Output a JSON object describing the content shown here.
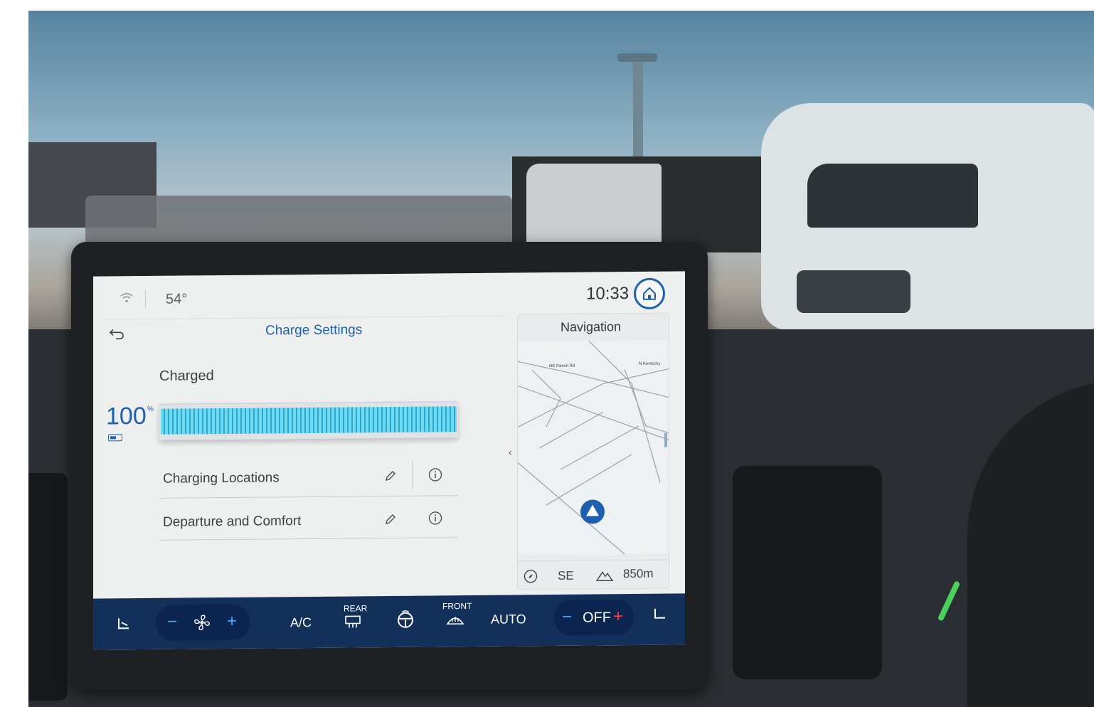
{
  "status_bar": {
    "temperature": "54°",
    "time": "10:33"
  },
  "charge_screen": {
    "title": "Charge Settings",
    "state_label": "Charged",
    "percent": "100",
    "percent_unit": "%",
    "battery_level": 1.0,
    "rows": [
      {
        "label": "Charging Locations"
      },
      {
        "label": "Departure and Comfort"
      }
    ]
  },
  "navigation": {
    "title": "Navigation",
    "streets": [
      "NE Parvin Rd",
      "N Kentucky"
    ],
    "heading": "SE",
    "elevation": "850m"
  },
  "climate": {
    "rear_label": "REAR",
    "front_label": "FRONT",
    "ac_label": "A/C",
    "auto_label": "AUTO",
    "off_label": "OFF",
    "minus": "−",
    "plus": "+"
  },
  "colors": {
    "accent": "#1f5fb0",
    "bar": "#3fc6e0",
    "climate_bg": "#12305a"
  },
  "icons": [
    "wifi-icon",
    "home-icon",
    "back-arrow-icon",
    "battery-icon",
    "pencil-icon",
    "info-icon",
    "compass-icon",
    "mountain-icon",
    "seat-heat-icon",
    "fan-icon",
    "rear-defrost-icon",
    "steering-heat-icon",
    "front-defrost-icon",
    "seat-cool-icon"
  ]
}
